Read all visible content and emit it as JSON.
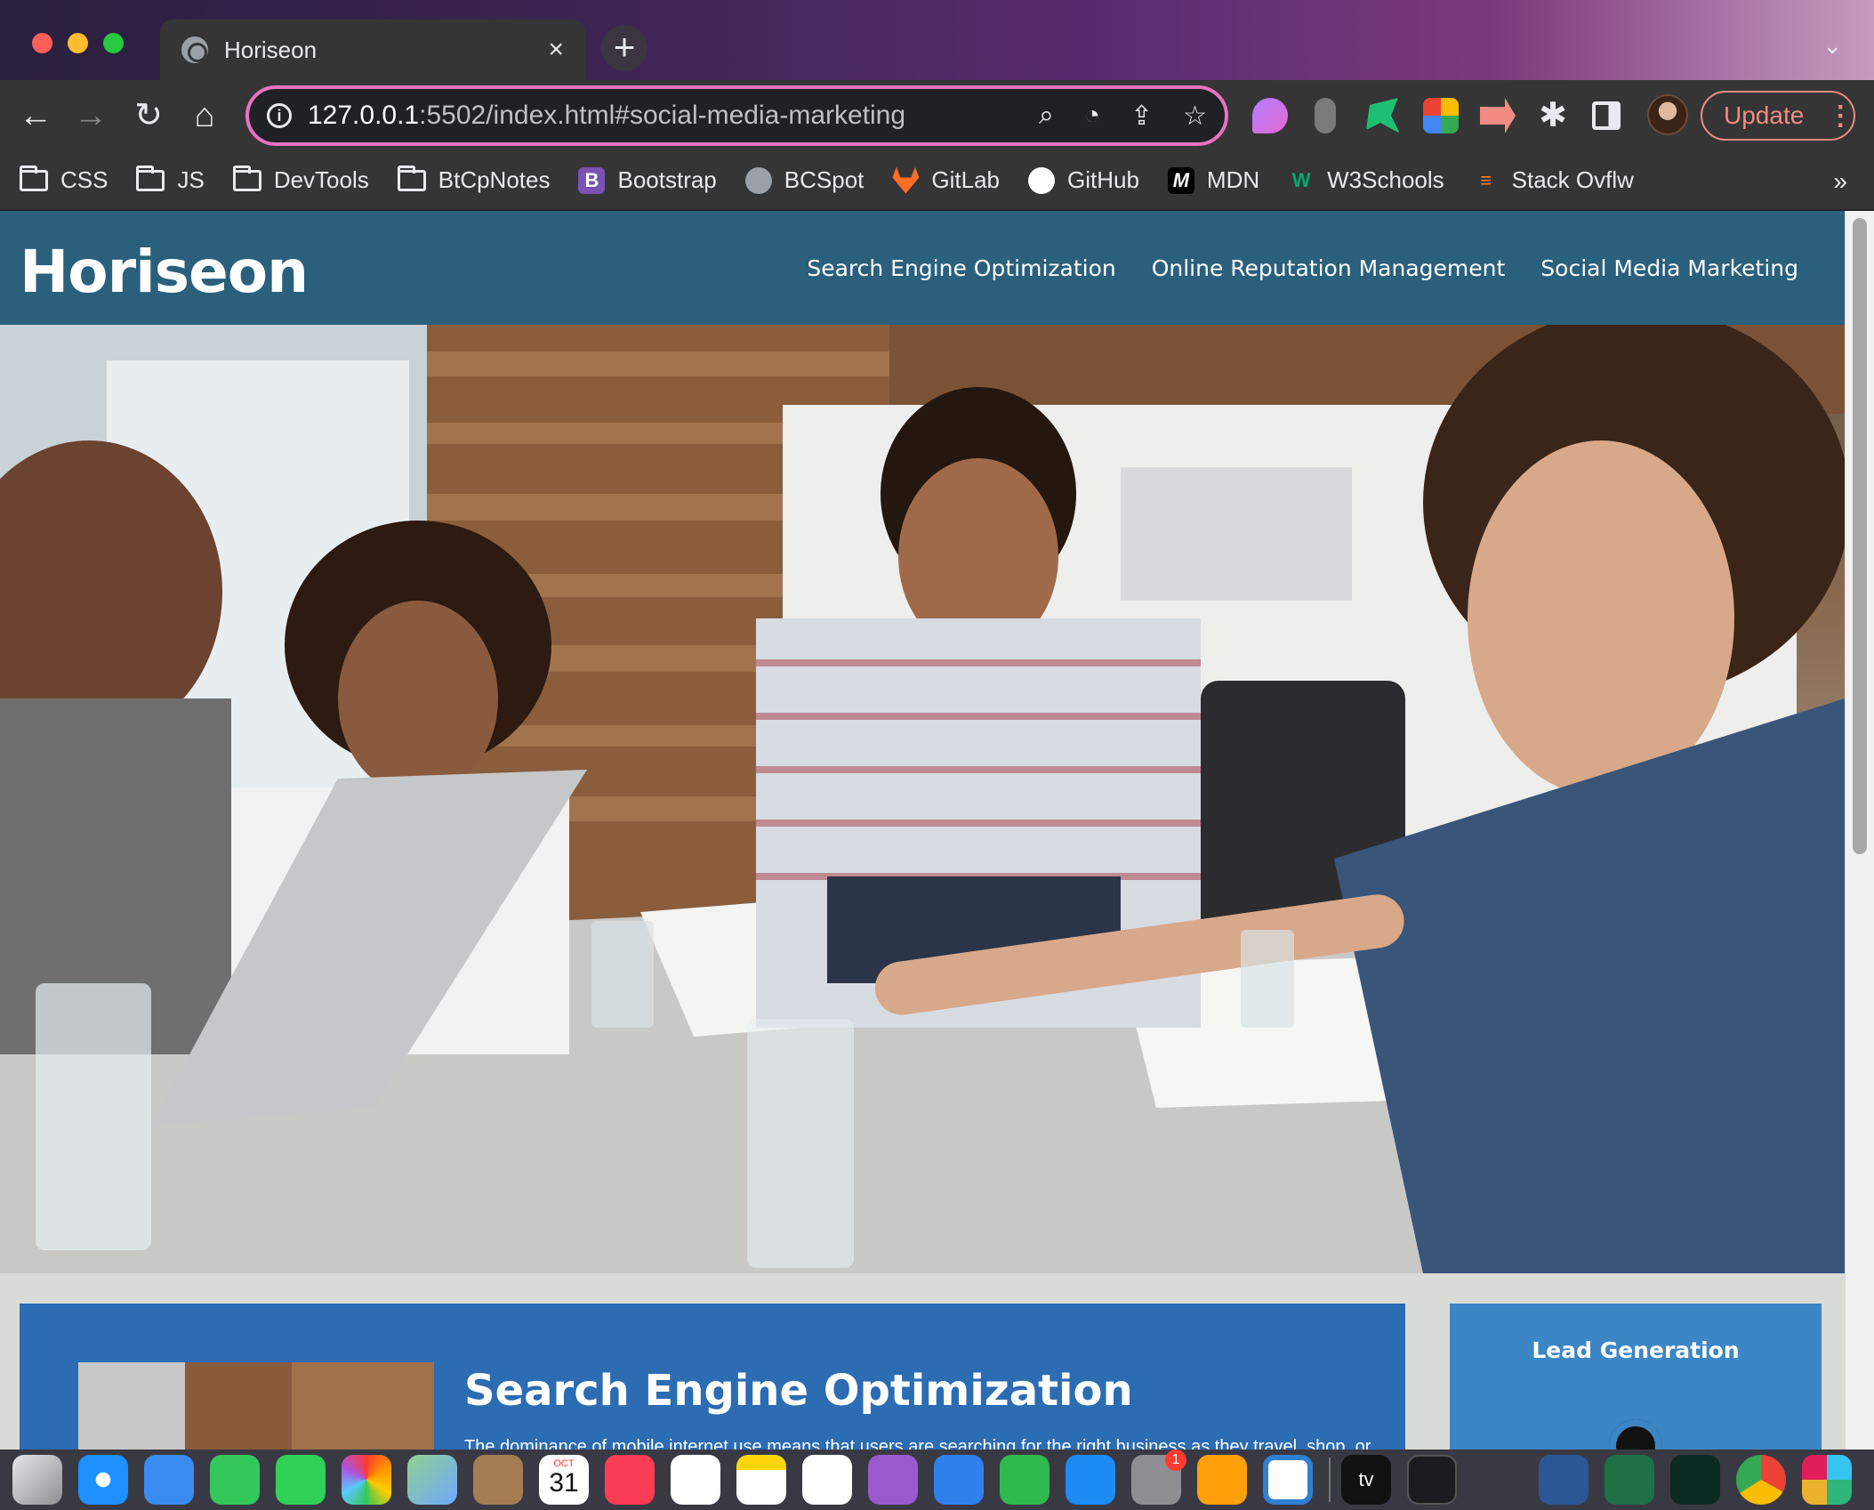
{
  "browser": {
    "tab_title": "Horiseon",
    "tab_close": "×",
    "new_tab": "+",
    "tab_menu": "⌄",
    "url_host": "127.0.0.1",
    "url_path": ":5502/index.html#social-media-marketing",
    "update_label": "Update",
    "update_menu": "⋮",
    "bookmarks_overflow": "»"
  },
  "bookmarks": [
    {
      "label": "CSS",
      "icon": "folder-icon"
    },
    {
      "label": "JS",
      "icon": "folder-icon"
    },
    {
      "label": "DevTools",
      "icon": "folder-icon"
    },
    {
      "label": "BtCpNotes",
      "icon": "folder-icon"
    },
    {
      "label": "Bootstrap",
      "icon": "bootstrap-icon",
      "glyph": "B",
      "color": "#7952b3"
    },
    {
      "label": "BCSpot",
      "icon": "globe-icon",
      "glyph": "",
      "color": "#9aa0a6"
    },
    {
      "label": "GitLab",
      "icon": "gitlab-icon",
      "glyph": "",
      "color": "#fc6d26"
    },
    {
      "label": "GitHub",
      "icon": "github-icon",
      "glyph": "",
      "color": "#ffffff"
    },
    {
      "label": "MDN",
      "icon": "mdn-icon",
      "glyph": "M",
      "color": "#000000"
    },
    {
      "label": "W3Schools",
      "icon": "w3schools-icon",
      "glyph": "W",
      "color": "#04aa6d"
    },
    {
      "label": "Stack Ovflw",
      "icon": "stackoverflow-icon",
      "glyph": "≡",
      "color": "#f48024"
    }
  ],
  "site": {
    "logo": "Horiseon",
    "nav": [
      "Search Engine Optimization",
      "Online Reputation Management",
      "Social Media Marketing"
    ],
    "card_heading": "Search Engine Optimization",
    "card_text": "The dominance of mobile internet use means that users are searching for the right business as they travel, shop, or",
    "side_heading": "Lead Generation"
  },
  "colors": {
    "header": "#2a607c",
    "card": "#2b6cb3",
    "side_card": "#3d86c6",
    "omnibox_border": "#e872c0",
    "update": "#f28b82"
  },
  "dock": {
    "calendar_month": "OCT",
    "calendar_day": "31",
    "settings_badge": "1",
    "tv_label": "tv",
    "icons": [
      "launchpad-icon",
      "safari-icon",
      "mail-icon",
      "facetime-icon",
      "messages-icon",
      "photos-icon",
      "maps-icon",
      "contacts-icon",
      "calendar-icon",
      "music-icon",
      "reminders-icon",
      "notes-icon",
      "freeform-icon",
      "podcasts-icon",
      "keynote-icon",
      "numbers-icon",
      "appstore-icon",
      "settings-icon",
      "pages-icon",
      "vscode-icon",
      "appletv-icon",
      "terminal-icon",
      "pen-icon",
      "word-icon",
      "excel-icon",
      "activity-monitor-icon",
      "chrome-icon",
      "slack-icon"
    ]
  }
}
